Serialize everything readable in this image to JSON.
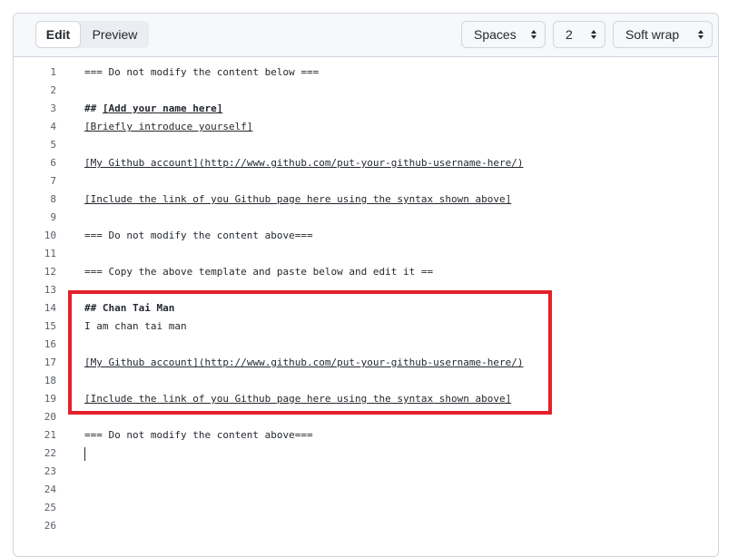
{
  "toolbar": {
    "tab_edit": "Edit",
    "tab_preview": "Preview",
    "indent_mode": "Spaces",
    "indent_size": "2",
    "wrap_mode": "Soft wrap"
  },
  "editor": {
    "lines": [
      {
        "n": "1",
        "parts": [
          {
            "t": "=== Do not modify the content below ==="
          }
        ]
      },
      {
        "n": "2",
        "parts": []
      },
      {
        "n": "3",
        "parts": [
          {
            "t": "## ",
            "b": true
          },
          {
            "t": "[Add your name here]",
            "b": true,
            "u": true
          }
        ]
      },
      {
        "n": "4",
        "parts": [
          {
            "t": "[Briefly introduce yourself]",
            "u": true
          }
        ]
      },
      {
        "n": "5",
        "parts": []
      },
      {
        "n": "6",
        "parts": [
          {
            "t": "[My Github account]",
            "u": true
          },
          {
            "t": "(http://www.github.com/put-your-github-username-here/)",
            "u": true
          }
        ]
      },
      {
        "n": "7",
        "parts": []
      },
      {
        "n": "8",
        "parts": [
          {
            "t": "[Include the link of you Github page here using the syntax shown above]",
            "u": true
          }
        ]
      },
      {
        "n": "9",
        "parts": []
      },
      {
        "n": "10",
        "parts": [
          {
            "t": "=== Do not modify the content above==="
          }
        ]
      },
      {
        "n": "11",
        "parts": []
      },
      {
        "n": "12",
        "parts": [
          {
            "t": "=== Copy the above template and paste below and edit it =="
          }
        ]
      },
      {
        "n": "13",
        "parts": []
      },
      {
        "n": "14",
        "parts": [
          {
            "t": "## Chan Tai Man",
            "b": true
          }
        ]
      },
      {
        "n": "15",
        "parts": [
          {
            "t": "I am chan tai man"
          }
        ]
      },
      {
        "n": "16",
        "parts": []
      },
      {
        "n": "17",
        "parts": [
          {
            "t": "[My Github account]",
            "u": true
          },
          {
            "t": "(http://www.github.com/put-your-github-username-here/)",
            "u": true
          }
        ]
      },
      {
        "n": "18",
        "parts": []
      },
      {
        "n": "19",
        "parts": [
          {
            "t": "[Include the link of you Github page here using the syntax shown above]",
            "u": true
          }
        ]
      },
      {
        "n": "20",
        "parts": []
      },
      {
        "n": "21",
        "parts": [
          {
            "t": "=== Do not modify the content above==="
          }
        ]
      },
      {
        "n": "22",
        "parts": []
      },
      {
        "n": "23",
        "parts": []
      },
      {
        "n": "24",
        "parts": []
      },
      {
        "n": "25",
        "parts": []
      },
      {
        "n": "26",
        "parts": []
      }
    ]
  },
  "colors": {
    "highlight_border": "#e3202a",
    "toolbar_bg": "#f6f8fa",
    "text": "#24292f",
    "line_number": "#57606a"
  }
}
